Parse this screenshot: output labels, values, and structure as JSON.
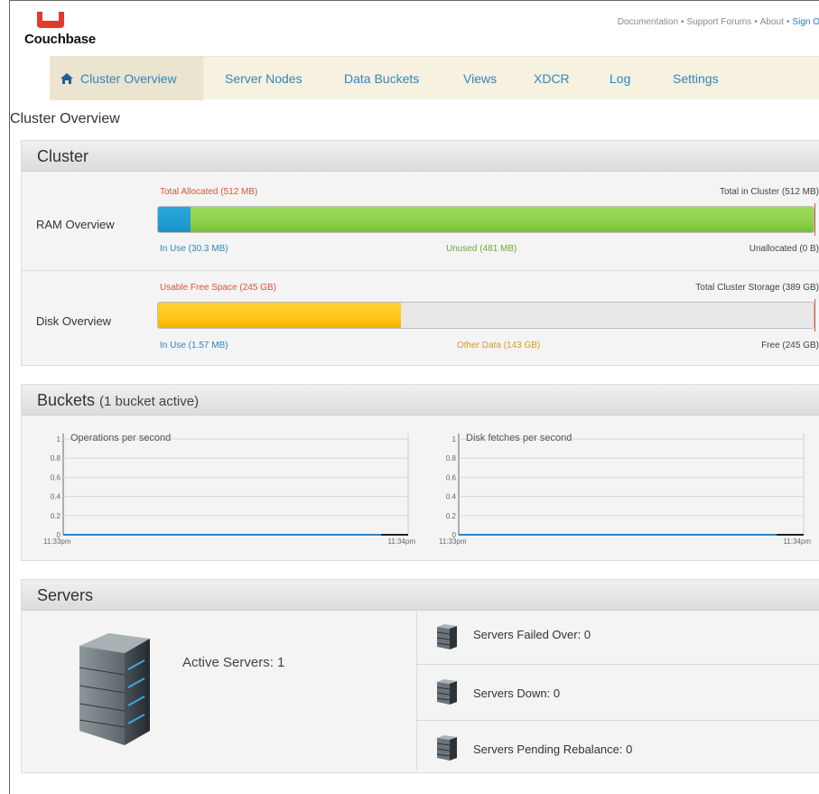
{
  "header": {
    "logo_text": "Couchbase",
    "links": [
      "Documentation",
      "Support Forums",
      "About",
      "Sign O"
    ],
    "separator": "•",
    "brand_color": "#e23a2e"
  },
  "nav": {
    "items": [
      {
        "label": "Cluster Overview",
        "active": true
      },
      {
        "label": "Server Nodes"
      },
      {
        "label": "Data Buckets"
      },
      {
        "label": "Views"
      },
      {
        "label": "XDCR"
      },
      {
        "label": "Log"
      },
      {
        "label": "Settings"
      }
    ]
  },
  "page_title": "Cluster Overview",
  "cluster": {
    "title": "Cluster",
    "ram": {
      "label": "RAM Overview",
      "top_left": "Total Allocated (512 MB)",
      "top_right": "Total in Cluster (512 MB)",
      "in_use": "In Use (30.3 MB)",
      "unused": "Unused (481 MB)",
      "unallocated": "Unallocated (0 B)",
      "in_use_fraction": 0.05,
      "unused_fraction": 0.95
    },
    "disk": {
      "label": "Disk Overview",
      "top_left": "Usable Free Space (245 GB)",
      "top_right": "Total Cluster Storage (389 GB)",
      "in_use": "In Use (1.57 MB)",
      "other": "Other Data (143 GB)",
      "free": "Free (245 GB)",
      "other_fraction": 0.37
    },
    "colors": {
      "in_use": "#29a9df",
      "unused": "#8ed14b",
      "other": "#ffc617",
      "free": "#e8e8e8"
    }
  },
  "buckets": {
    "title": "Buckets",
    "subtitle": "(1 bucket active)",
    "charts": [
      {
        "title": "Operations per second",
        "yticks": [
          "1",
          "0.8",
          "0.6",
          "0.4",
          "0.2",
          "0"
        ],
        "x_start": "11:33pm",
        "x_end": "11:34pm"
      },
      {
        "title": "Disk fetches per second",
        "yticks": [
          "1",
          "0.8",
          "0.6",
          "0.4",
          "0.2",
          "0"
        ],
        "x_start": "11:33pm",
        "x_end": "11:34pm"
      }
    ]
  },
  "servers": {
    "title": "Servers",
    "active": "Active Servers: 1",
    "failed_over": "Servers Failed Over: 0",
    "down": "Servers Down: 0",
    "pending": "Servers Pending Rebalance: 0"
  },
  "chart_data": [
    {
      "type": "line",
      "title": "Operations per second",
      "x": [
        "11:33pm",
        "11:34pm"
      ],
      "series": [
        {
          "values": [
            0,
            0
          ]
        }
      ],
      "ylim": [
        0,
        1
      ],
      "grid": true
    },
    {
      "type": "line",
      "title": "Disk fetches per second",
      "x": [
        "11:33pm",
        "11:34pm"
      ],
      "series": [
        {
          "values": [
            0,
            0
          ]
        }
      ],
      "ylim": [
        0,
        1
      ],
      "grid": true
    }
  ]
}
